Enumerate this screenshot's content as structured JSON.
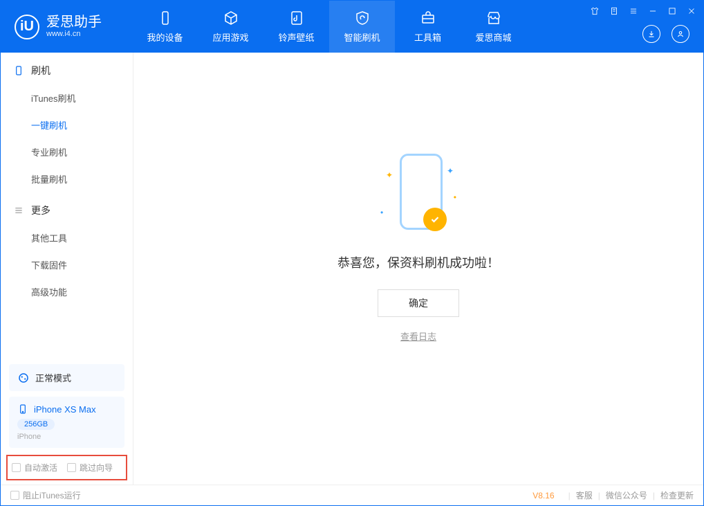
{
  "app": {
    "name": "爱思助手",
    "site": "www.i4.cn"
  },
  "nav": {
    "items": [
      {
        "label": "我的设备"
      },
      {
        "label": "应用游戏"
      },
      {
        "label": "铃声壁纸"
      },
      {
        "label": "智能刷机"
      },
      {
        "label": "工具箱"
      },
      {
        "label": "爱思商城"
      }
    ]
  },
  "sidebar": {
    "groups": [
      {
        "title": "刷机",
        "items": [
          "iTunes刷机",
          "一键刷机",
          "专业刷机",
          "批量刷机"
        ]
      },
      {
        "title": "更多",
        "items": [
          "其他工具",
          "下载固件",
          "高级功能"
        ]
      }
    ],
    "mode": "正常模式",
    "device": {
      "name": "iPhone XS Max",
      "capacity": "256GB",
      "type": "iPhone"
    },
    "checks": {
      "auto_activate": "自动激活",
      "skip_guide": "跳过向导"
    }
  },
  "main": {
    "success": "恭喜您，保资料刷机成功啦！",
    "ok": "确定",
    "log": "查看日志"
  },
  "footer": {
    "block_itunes": "阻止iTunes运行",
    "version": "V8.16",
    "links": [
      "客服",
      "微信公众号",
      "检查更新"
    ]
  }
}
